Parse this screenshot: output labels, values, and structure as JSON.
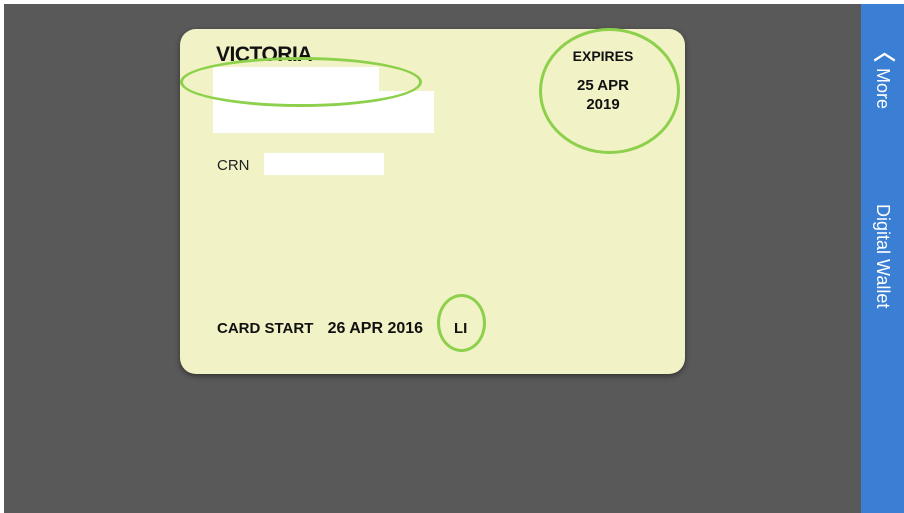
{
  "card": {
    "state": "VICTORIA",
    "crn_label": "CRN",
    "expires_label": "EXPIRES",
    "expires_date": "25 APR 2019",
    "card_start_label": "CARD START",
    "card_start_date": "26 APR 2016",
    "license_type": "LI"
  },
  "sidebar": {
    "more_label": "More",
    "digital_wallet_label": "Digital Wallet"
  },
  "icons": {
    "more": "chevron-left-icon"
  },
  "colors": {
    "background": "#595959",
    "card": "#f1f2c5",
    "highlight": "#8dd04b",
    "sidebar": "#3b7fd4"
  }
}
